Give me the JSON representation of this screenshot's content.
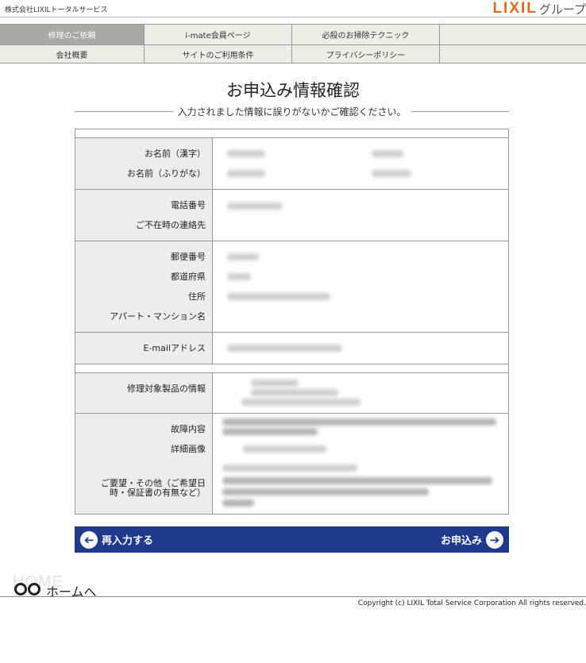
{
  "header": {
    "company": "株式会社LIXILトータルサービス",
    "logo_mark": "LIXIL",
    "logo_sub": "グループ"
  },
  "nav": {
    "row1": [
      "修理のご依頼",
      "i-mate会員ページ",
      "必殺のお掃除テクニック",
      ""
    ],
    "row2": [
      "会社概要",
      "サイトのご利用条件",
      "プライバシーポリシー",
      ""
    ]
  },
  "page": {
    "title": "お申込み情報確認",
    "subtitle": "入力されました情報に誤りがないかご確認ください。"
  },
  "form": {
    "name_kanji": "お名前（漢字）",
    "name_kana": "お名前（ふりがな）",
    "phone": "電話番号",
    "alt_contact": "ご不在時の連絡先",
    "postal": "郵便番号",
    "prefecture": "都道府県",
    "address": "住所",
    "building": "アパート・マンション名",
    "email": "E-mailアドレス",
    "product_info": "修理対象製品の情報",
    "fault": "故障内容",
    "detail_image": "詳細画像",
    "requests": "ご要望・その他（ご希望日時・保証書の有無など）"
  },
  "actions": {
    "back_label": "再入力する",
    "submit_label": "お申込み"
  },
  "footer": {
    "home_ghost": "HOME",
    "home_label": "ホームへ",
    "copyright": "Copyright (c) LIXIL Total Service Corporation All rights reserved."
  },
  "colors": {
    "nav_active": "#a8a8a4",
    "nav_bg": "#efeee6",
    "action_bar": "#1f3a8c",
    "logo": "#e06a1b",
    "label_bg": "#ededed"
  }
}
